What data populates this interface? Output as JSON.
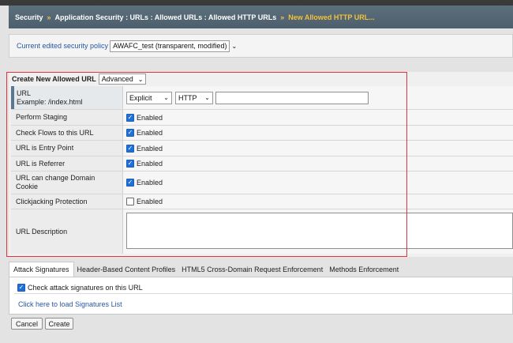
{
  "breadcrumb": {
    "root": "Security",
    "path": "Application Security : URLs : Allowed URLs : Allowed HTTP URLs",
    "current": "New Allowed HTTP URL..."
  },
  "policy": {
    "label": "Current edited security policy",
    "value": "AWAFC_test (transparent, modified)"
  },
  "create": {
    "title": "Create New Allowed URL",
    "mode": "Advanced"
  },
  "form": {
    "url_label": "URL",
    "url_example": "Example: /index.html",
    "url_type": "Explicit",
    "protocol": "HTTP",
    "url_value": "",
    "rows": [
      {
        "label": "Perform Staging",
        "checked": true,
        "value": "Enabled"
      },
      {
        "label": "Check Flows to this URL",
        "checked": true,
        "value": "Enabled"
      },
      {
        "label": "URL is Entry Point",
        "checked": true,
        "value": "Enabled"
      },
      {
        "label": "URL is Referrer",
        "checked": true,
        "value": "Enabled"
      },
      {
        "label": "URL can change Domain Cookie",
        "checked": true,
        "value": "Enabled"
      },
      {
        "label": "Clickjacking Protection",
        "checked": false,
        "value": "Enabled"
      }
    ],
    "description_label": "URL Description",
    "description_value": ""
  },
  "tabs": [
    {
      "label": "Attack Signatures",
      "active": true
    },
    {
      "label": "Header-Based Content Profiles",
      "active": false
    },
    {
      "label": "HTML5 Cross-Domain Request Enforcement",
      "active": false
    },
    {
      "label": "Methods Enforcement",
      "active": false
    }
  ],
  "signatures": {
    "check_label": "Check attack signatures on this URL",
    "checked": true,
    "load_link": "Click here to load Signatures List"
  },
  "buttons": {
    "cancel": "Cancel",
    "create": "Create"
  },
  "colors": {
    "accent": "#f3c13a",
    "link": "#2757a3",
    "highlight": "#e0353b"
  }
}
